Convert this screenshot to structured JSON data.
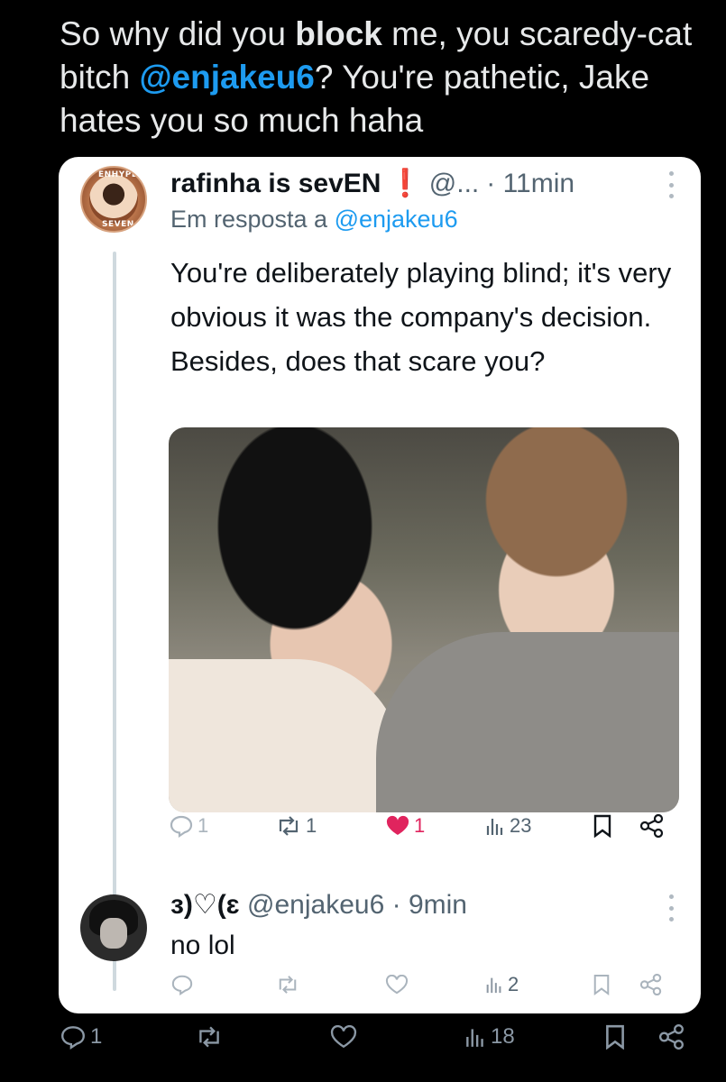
{
  "quote": {
    "part1": "So why did you ",
    "bold": "block",
    "part2": " me, you scaredy-cat bitch ",
    "mention": "@enjakeu6",
    "part3": "? You're pathetic, Jake hates you so much haha"
  },
  "tweet": {
    "avatar_text_top": "ENHYPEN",
    "avatar_text_bottom": "SEVEN",
    "name": "rafinha is sevEN",
    "badge": "❗",
    "handle": "@...",
    "time": "· 11min",
    "reply_prefix": "Em resposta a ",
    "reply_mention": "@enjakeu6",
    "body": "You're deliberately playing blind; it's very obvious it was the company's decision. Besides, does that scare you?",
    "replies": "1",
    "retweets": "1",
    "likes": "1",
    "views": "23"
  },
  "reply": {
    "name": "ɜ)♡(ɛ",
    "handle": "@enjakeu6",
    "time": "· 9min",
    "body": "no lol",
    "views": "2"
  },
  "outer_actions": {
    "replies": "1",
    "views": "18"
  },
  "colors": {
    "accent": "#1d9bf0",
    "like": "#e0245e",
    "muted": "#536471"
  }
}
